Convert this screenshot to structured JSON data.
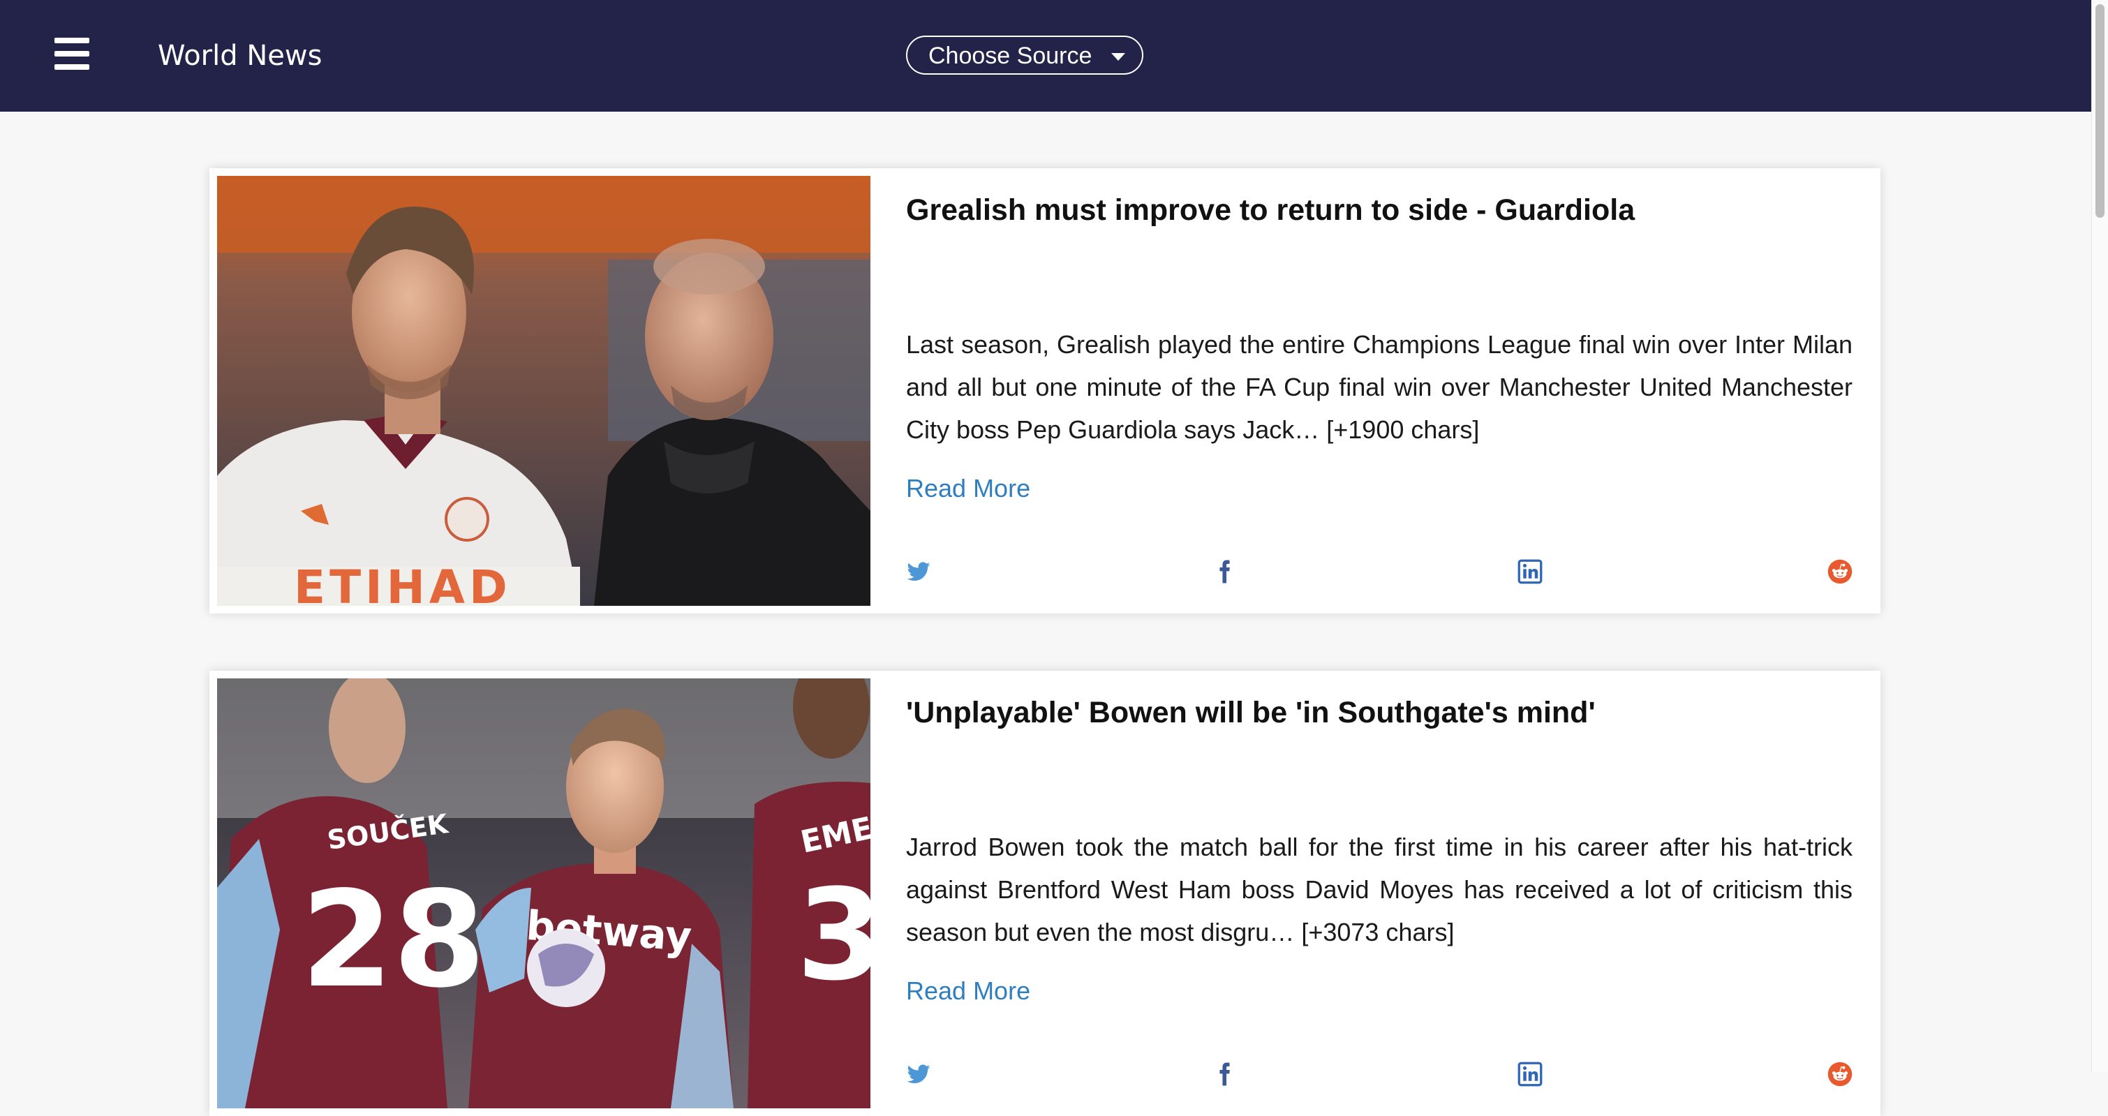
{
  "header": {
    "title": "World News",
    "source_select": {
      "label": "Choose Source",
      "caret_icon": "chevron-down-icon"
    },
    "menu_icon": "hamburger-icon"
  },
  "colors": {
    "header_bg": "#23234a",
    "link": "#2f7fc0",
    "twitter": "#4d97d6",
    "facebook": "#3b5998",
    "linkedin": "#3066b5",
    "reddit": "#e85a2e"
  },
  "articles": [
    {
      "title": "Grealish must improve to return to side - Guardiola",
      "description": "Last season, Grealish played the entire Champions League final win over Inter Milan and all but one minute of the FA Cup final win over Manchester United Manchester City boss Pep Guardiola says Jack… [+1900 chars]",
      "read_more": "Read More",
      "image_text": "ETIHAD",
      "share_icons": [
        "twitter-icon",
        "facebook-icon",
        "linkedin-icon",
        "reddit-icon"
      ]
    },
    {
      "title": "'Unplayable' Bowen will be 'in Southgate's mind'",
      "description": "Jarrod Bowen took the match ball for the first time in his career after his hat-trick against Brentford West Ham boss David Moyes has received a lot of criticism this season but even the most disgru… [+3073 chars]",
      "read_more": "Read More",
      "image_text": [
        "SOUČEK",
        "28",
        "betway",
        "EMERS"
      ],
      "share_icons": [
        "twitter-icon",
        "facebook-icon",
        "linkedin-icon",
        "reddit-icon"
      ]
    }
  ]
}
